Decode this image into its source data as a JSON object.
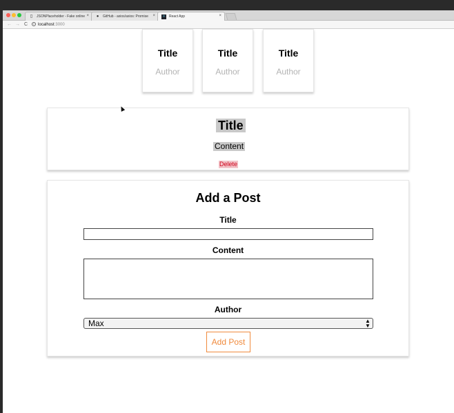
{
  "browser": {
    "tabs": [
      {
        "label": "JSONPlaceholder - Fake online",
        "icon": "document-icon",
        "close": "×"
      },
      {
        "label": "GitHub - axios/axios: Promise",
        "icon": "github-icon",
        "close": "×"
      },
      {
        "label": "React App",
        "icon": "react-icon",
        "close": "×"
      }
    ],
    "url_host": "localhost",
    "url_port": ":3000"
  },
  "posts": [
    {
      "title": "Title",
      "author": "Author"
    },
    {
      "title": "Title",
      "author": "Author"
    },
    {
      "title": "Title",
      "author": "Author"
    }
  ],
  "full_post": {
    "title": "Title",
    "content": "Content",
    "delete_label": "Delete"
  },
  "new_post": {
    "heading": "Add a Post",
    "title_label": "Title",
    "title_value": "",
    "content_label": "Content",
    "content_value": "",
    "author_label": "Author",
    "author_selected": "Max",
    "submit_label": "Add Post"
  },
  "colors": {
    "delete": "#d0021b",
    "add_button": "#f08a3c",
    "author_text": "#b3b3b3",
    "highlight": "#c9c9c9"
  }
}
